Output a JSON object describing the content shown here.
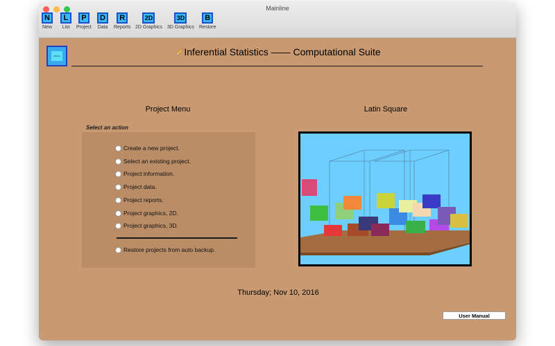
{
  "window": {
    "title": "Mainline",
    "traffic_lights": {
      "close": "#fc605b",
      "minimize": "#fdbc40",
      "zoom": "#34c84a"
    }
  },
  "toolbar": {
    "items": [
      {
        "glyph": "N",
        "label": "New"
      },
      {
        "glyph": "L",
        "label": "List"
      },
      {
        "glyph": "P",
        "label": "Project"
      },
      {
        "glyph": "D",
        "label": "Data"
      },
      {
        "glyph": "R",
        "label": "Reports"
      },
      {
        "glyph": "2D",
        "label": "2D Graphics"
      },
      {
        "glyph": "3D",
        "label": "3D Graphics"
      },
      {
        "glyph": "B",
        "label": "Restore"
      }
    ]
  },
  "header": {
    "logo_text": "SMCSI",
    "title_icon": "pencil-icon",
    "title": "Inferential Statistics —— Computational Suite"
  },
  "left_panel": {
    "heading": "Project Menu",
    "group_label": "Select an action",
    "actions": [
      "Create a new project.",
      "Select an existing project.",
      "Project information.",
      "Project data.",
      "Project reports.",
      "Project graphics, 2D.",
      "Project graphics, 3D."
    ],
    "restore_action": "Restore projects from auto backup."
  },
  "right_panel": {
    "heading": "Latin Square",
    "image": "3d-latin-square-cube-plot"
  },
  "footer": {
    "date": "Thursday; Nov 10, 2016",
    "manual_button": "User Manual"
  },
  "colors": {
    "background": "#c99a72",
    "panel": "#bb8d67",
    "toolbar_button": "#38b8ff",
    "toolbar_button_border": "#1750c8",
    "plot_background": "#6ccfff",
    "plot_floor": "#a36d40"
  }
}
